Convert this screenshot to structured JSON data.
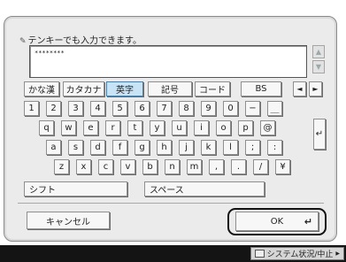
{
  "hint": {
    "icon": "✎",
    "text": "テンキーでも入力できます。"
  },
  "input": {
    "value": "********"
  },
  "scroll": {
    "up": "▲",
    "down": "▼"
  },
  "modes": [
    "かな漢",
    "カタカナ",
    "英字",
    "記号",
    "コード",
    "BS"
  ],
  "selected_mode": "英字",
  "nav": {
    "left": "◄",
    "right": "►"
  },
  "rows": [
    [
      "1",
      "2",
      "3",
      "4",
      "5",
      "6",
      "7",
      "8",
      "9",
      "0",
      "−",
      "＿"
    ],
    [
      "q",
      "w",
      "e",
      "r",
      "t",
      "y",
      "u",
      "i",
      "o",
      "p",
      "@"
    ],
    [
      "a",
      "s",
      "d",
      "f",
      "g",
      "h",
      "j",
      "k",
      "l",
      ";",
      ":"
    ],
    [
      "z",
      "x",
      "c",
      "v",
      "b",
      "n",
      "m",
      ",",
      ".",
      "/",
      "¥"
    ]
  ],
  "enter_key": "↵",
  "shift_label": "シフト",
  "space_label": "スペース",
  "cancel_label": "キャンセル",
  "ok_label": "OK",
  "ok_enter": "↵",
  "status": {
    "label": "システム状況/中止",
    "arrow": "▶"
  },
  "colors": {
    "selected_key": "#c8e3f5",
    "status_bar": "#141414"
  }
}
